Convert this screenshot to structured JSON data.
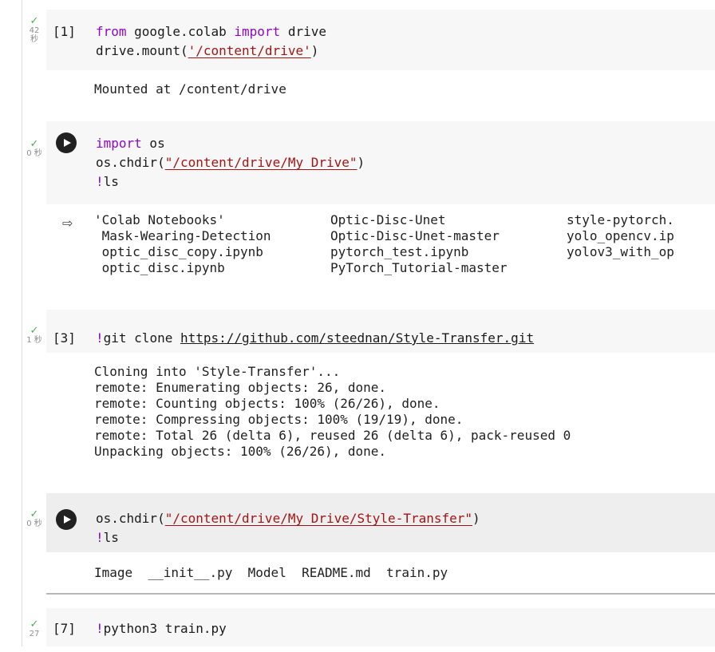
{
  "cells": [
    {
      "count": "[1]",
      "status": {
        "time_top": "42",
        "time_bottom": "秒"
      },
      "code": [
        [
          {
            "t": "from",
            "c": "kw"
          },
          {
            "t": " google.colab ",
            "c": ""
          },
          {
            "t": "import",
            "c": "kw"
          },
          {
            "t": " drive",
            "c": ""
          }
        ],
        [
          {
            "t": "drive.mount(",
            "c": ""
          },
          {
            "t": "'/content/drive'",
            "c": "str"
          },
          {
            "t": ")",
            "c": ""
          }
        ]
      ],
      "output": "Mounted at /content/drive"
    },
    {
      "count": "",
      "status": {
        "time_top": "0 秒",
        "time_bottom": ""
      },
      "code": [
        [
          {
            "t": "import",
            "c": "kw"
          },
          {
            "t": " os",
            "c": ""
          }
        ],
        [
          {
            "t": "os.chdir(",
            "c": ""
          },
          {
            "t": "\"/content/drive/My Drive\"",
            "c": "str"
          },
          {
            "t": ")",
            "c": ""
          }
        ],
        [
          {
            "t": "!",
            "c": "bang"
          },
          {
            "t": "ls",
            "c": ""
          }
        ]
      ],
      "ls_columns": [
        [
          "'Colab Notebooks'",
          " Mask-Wearing-Detection",
          " optic_disc_copy.ipynb",
          " optic_disc.ipynb"
        ],
        [
          "Optic-Disc-Unet",
          "Optic-Disc-Unet-master",
          "pytorch_test.ipynb",
          "PyTorch_Tutorial-master"
        ],
        [
          "style-pytorch.",
          "yolo_opencv.ip",
          "yolov3_with_op",
          ""
        ]
      ]
    },
    {
      "count": "[3]",
      "status": {
        "time_top": "1 秒",
        "time_bottom": ""
      },
      "code": [
        [
          {
            "t": "!",
            "c": "bang"
          },
          {
            "t": "git clone ",
            "c": ""
          },
          {
            "t": "https://github.com/steednan/Style-Transfer.git",
            "c": "link"
          }
        ]
      ],
      "output": "Cloning into 'Style-Transfer'...\nremote: Enumerating objects: 26, done.\nremote: Counting objects: 100% (26/26), done.\nremote: Compressing objects: 100% (19/19), done.\nremote: Total 26 (delta 6), reused 26 (delta 6), pack-reused 0\nUnpacking objects: 100% (26/26), done."
    },
    {
      "count": "",
      "status": {
        "time_top": "0 秒",
        "time_bottom": ""
      },
      "code": [
        [
          {
            "t": "os.chdir(",
            "c": ""
          },
          {
            "t": "\"/content/drive/My Drive/Style-Transfer\"",
            "c": "str"
          },
          {
            "t": ")",
            "c": ""
          }
        ],
        [
          {
            "t": "!",
            "c": "bang"
          },
          {
            "t": "ls",
            "c": ""
          }
        ]
      ],
      "output": "Image  __init__.py  Model  README.md  train.py"
    },
    {
      "count": "[7]",
      "status": {
        "time_top": "27",
        "time_bottom": ""
      },
      "code": [
        [
          {
            "t": "!",
            "c": "bang"
          },
          {
            "t": "python3 train.py",
            "c": ""
          }
        ]
      ]
    }
  ]
}
